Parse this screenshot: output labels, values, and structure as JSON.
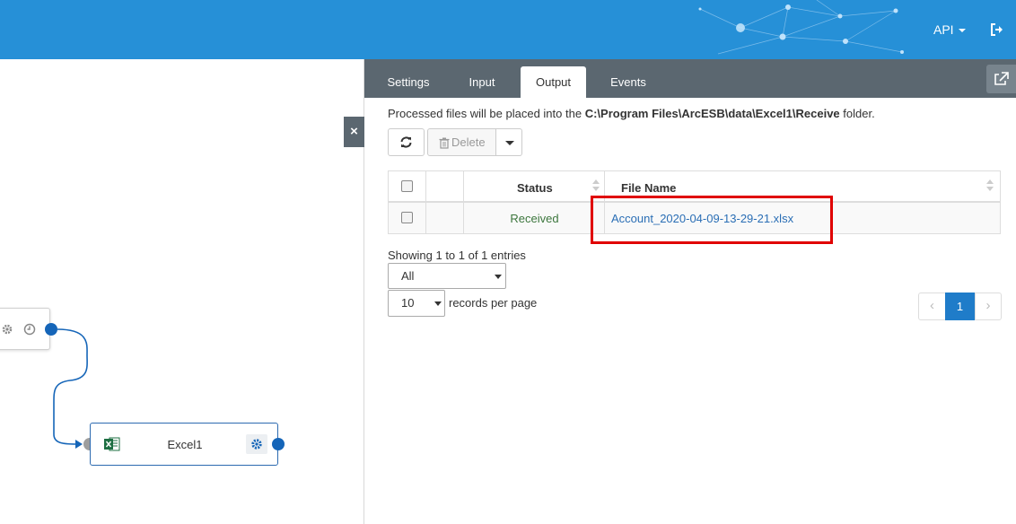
{
  "header": {
    "api_label": "API"
  },
  "canvas": {
    "node_excel_label": "Excel1",
    "close_label": "×"
  },
  "panel": {
    "tabs": [
      {
        "label": "Settings"
      },
      {
        "label": "Input"
      },
      {
        "label": "Output"
      },
      {
        "label": "Events"
      }
    ],
    "active_tab": "Output",
    "info": {
      "prefix": "Processed files will be placed into the ",
      "path": "C:\\Program Files\\ArcESB\\data\\Excel1\\Receive",
      "suffix": " folder."
    },
    "toolbar": {
      "delete_label": "Delete"
    },
    "table": {
      "headers": {
        "status": "Status",
        "file_name": "File Name"
      },
      "rows": [
        {
          "status": "Received",
          "file_name": "Account_2020-04-09-13-29-21.xlsx"
        }
      ]
    },
    "showing_text": "Showing 1 to 1 of 1 entries",
    "filter_select": "All",
    "page_size_select": "10",
    "records_label": "records per page",
    "pagination": {
      "prev": "‹",
      "current": "1",
      "next": "›"
    }
  },
  "colors": {
    "topbar": "#2690d7",
    "tabbar": "#5b6770",
    "status_received": "#3c763d",
    "link": "#2a6eb5",
    "highlight": "#e00000",
    "port_out": "#1565b8"
  }
}
